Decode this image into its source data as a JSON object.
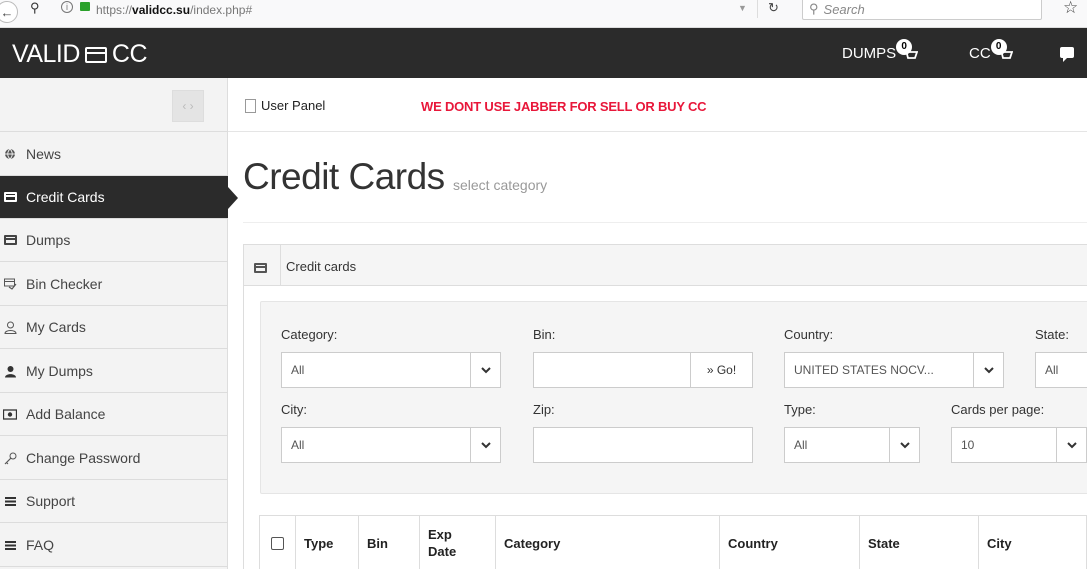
{
  "browser": {
    "url_prefix": "https://",
    "url_domain": "validcc.su",
    "url_path": "/index.php#",
    "search_placeholder": "Search"
  },
  "header": {
    "logo_left": "VALID",
    "logo_right": "CC",
    "dumps_label": "DUMPS",
    "dumps_count": "0",
    "cc_label": "CC",
    "cc_count": "0"
  },
  "sidebar": {
    "toggle_label": "‹ ›",
    "items": [
      {
        "label": "News",
        "icon": "globe-icon"
      },
      {
        "label": "Credit Cards",
        "icon": "credit-card-icon",
        "active": true
      },
      {
        "label": "Dumps",
        "icon": "credit-card-icon"
      },
      {
        "label": "Bin Checker",
        "icon": "card-check-icon"
      },
      {
        "label": "My Cards",
        "icon": "user-outline-icon"
      },
      {
        "label": "My Dumps",
        "icon": "user-icon"
      },
      {
        "label": "Add Balance",
        "icon": "money-icon"
      },
      {
        "label": "Change Password",
        "icon": "key-icon"
      },
      {
        "label": "Support",
        "icon": "list-icon"
      },
      {
        "label": "FAQ",
        "icon": "list-icon"
      }
    ]
  },
  "subbar": {
    "user_panel": "User Panel",
    "notice": "WE DONT USE JABBER FOR SELL OR BUY CC"
  },
  "page": {
    "title": "Credit Cards",
    "subtitle": "select category"
  },
  "panel": {
    "title": "Credit cards"
  },
  "filters": {
    "category_label": "Category:",
    "category_value": "All",
    "bin_label": "Bin:",
    "bin_value": "",
    "go_label": "» Go!",
    "country_label": "Country:",
    "country_value": "UNITED STATES NOCV...",
    "state_label": "State:",
    "state_value": "All",
    "city_label": "City:",
    "city_value": "All",
    "zip_label": "Zip:",
    "zip_value": "",
    "type_label": "Type:",
    "type_value": "All",
    "per_page_label": "Cards per page:",
    "per_page_value": "10"
  },
  "table": {
    "columns": [
      "Type",
      "Bin",
      "Exp Date",
      "Category",
      "Country",
      "State",
      "City"
    ]
  },
  "colors": {
    "header_bg": "#2b2b2b",
    "notice": "#e8173a",
    "sidebar_bg": "#f3f3f3"
  }
}
